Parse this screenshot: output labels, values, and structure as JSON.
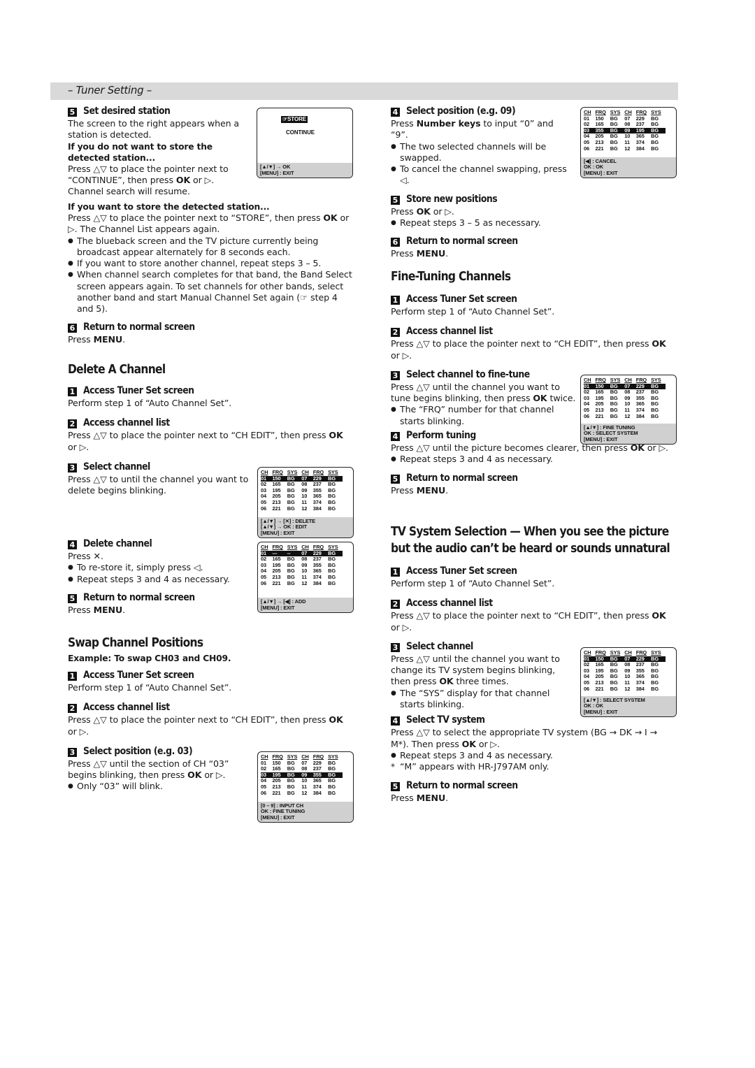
{
  "banner": {
    "title": "– Tuner Setting –"
  },
  "left": {
    "set_desired_station": {
      "num": "5",
      "title": "Set desired station",
      "p1": "The screen to the right appears when a station is detected.",
      "sub1": "If you do not want to store the detected station...",
      "p2a": "Press △▽ to place the pointer next to “CONTINUE”, then press ",
      "p2b": "OK",
      "p2c": " or ▷.",
      "p3": "Channel search will resume.",
      "sub2": "If you want to store the detected station...",
      "p4a": "Press △▽ to place the pointer next to “STORE”, then press ",
      "p4b": "OK",
      "p4c": " or ▷. The Channel List appears again.",
      "bullets": [
        "The blueback screen and the TV picture currently being broadcast appear alternately for 8 seconds each.",
        "If you want to store another channel, repeat steps 3 – 5.",
        "When channel search completes for that band, the Band Select screen appears again. To set channels for other bands, select another band and start Manual Channel Set again (☞ step 4 and 5)."
      ],
      "screen": {
        "store": "☞STORE",
        "continue": "CONTINUE",
        "foot1": "[▲/▼] → OK",
        "foot2": "[MENU] : EXIT"
      }
    },
    "return6": {
      "num": "6",
      "title": "Return to normal screen",
      "text_a": "Press ",
      "text_b": "MENU",
      "text_c": "."
    },
    "delete": {
      "heading": "Delete A Channel",
      "steps": [
        {
          "num": "1",
          "title": "Access Tuner Set screen",
          "text": "Perform step 1 of “Auto Channel Set”."
        },
        {
          "num": "2",
          "title": "Access channel list",
          "text_a": "Press △▽ to place the pointer next to “CH EDIT”, then press ",
          "text_b": "OK",
          "text_c": " or ▷."
        },
        {
          "num": "3",
          "title": "Select channel",
          "text": "Press △▽ to until the channel you want to delete begins blinking."
        },
        {
          "num": "4",
          "title": "Delete channel",
          "text": "Press ✕.",
          "bullets": [
            "To re-store it, simply press ◁.",
            "Repeat steps 3 and 4 as necessary."
          ]
        },
        {
          "num": "5",
          "title": "Return to normal screen",
          "text_a": "Press ",
          "text_b": "MENU",
          "text_c": "."
        }
      ],
      "screen1": {
        "foot": [
          "[▲/▼] → [✕] : DELETE",
          "[▲/▼] → OK : EDIT",
          "[MENU] : EXIT"
        ]
      },
      "screen2": {
        "foot": [
          "[▲/▼] → [◀] : ADD",
          "[MENU] : EXIT"
        ]
      }
    },
    "swap": {
      "heading": "Swap Channel Positions",
      "example": "Example: To swap CH03 and CH09.",
      "steps": [
        {
          "num": "1",
          "title": "Access Tuner Set screen",
          "text": "Perform step 1 of “Auto Channel Set”."
        },
        {
          "num": "2",
          "title": "Access channel list",
          "text_a": "Press △▽ to place the pointer next to “CH EDIT”, then press ",
          "text_b": "OK",
          "text_c": " or ▷."
        },
        {
          "num": "3",
          "title": "Select position (e.g. 03)",
          "text_a": "Press △▽ until the section of CH “03” begins blinking, then press ",
          "text_b": "OK",
          "text_c": " or ▷.",
          "bullets": [
            "Only “03” will blink."
          ]
        }
      ],
      "screen": {
        "foot": [
          "[0 – 9] : INPUT CH",
          "OK : FINE TUNING",
          "[MENU] : EXIT"
        ]
      }
    }
  },
  "right": {
    "swap_cont": {
      "steps": [
        {
          "num": "4",
          "title": "Select position (e.g. 09)",
          "text_a": "Press ",
          "text_b": "Number keys",
          "text_c": " to input “0” and “9”.",
          "bullets": [
            "The two selected channels will be swapped.",
            "To cancel the channel swapping, press ◁."
          ]
        },
        {
          "num": "5",
          "title": "Store new positions",
          "text_a": "Press ",
          "text_b": "OK",
          "text_c": " or ▷.",
          "bullets": [
            "Repeat steps 3 – 5 as necessary."
          ]
        },
        {
          "num": "6",
          "title": "Return to normal screen",
          "text_a": "Press ",
          "text_b": "MENU",
          "text_c": "."
        }
      ],
      "screen": {
        "foot": [
          "[◀] : CANCEL",
          "OK : OK",
          "[MENU] : EXIT"
        ]
      }
    },
    "fine": {
      "heading": "Fine-Tuning Channels",
      "steps": [
        {
          "num": "1",
          "title": "Access Tuner Set screen",
          "text": "Perform step 1 of “Auto Channel Set”."
        },
        {
          "num": "2",
          "title": "Access channel list",
          "text_a": "Press △▽ to place the pointer next to “CH EDIT”, then press ",
          "text_b": "OK",
          "text_c": " or ▷."
        },
        {
          "num": "3",
          "title": "Select channel to fine-tune",
          "text_a": "Press △▽ until the channel you want to tune begins blinking, then press ",
          "text_b": "OK",
          "text_c": " twice.",
          "bullets": [
            "The “FRQ” number for that channel starts blinking."
          ]
        },
        {
          "num": "4",
          "title": "Perform tuning",
          "text_a": "Press △▽ until the picture becomes clearer, then press ",
          "text_b": "OK",
          "text_c": " or ▷.",
          "bullets": [
            "Repeat steps 3 and 4 as necessary."
          ]
        },
        {
          "num": "5",
          "title": "Return to normal screen",
          "text_a": "Press ",
          "text_b": "MENU",
          "text_c": "."
        }
      ],
      "screen": {
        "foot": [
          "[▲/▼] : FINE TUNING",
          "OK : SELECT SYSTEM",
          "[MENU] : EXIT"
        ]
      }
    },
    "tvsys": {
      "heading1": "TV System Selection — When you see the picture",
      "heading2": "but the audio can’t be heard or sounds unnatural",
      "steps": [
        {
          "num": "1",
          "title": "Access Tuner Set screen",
          "text": "Perform step 1 of “Auto Channel Set”."
        },
        {
          "num": "2",
          "title": "Access channel list",
          "text_a": "Press △▽ to place the pointer next to “CH EDIT”, then press ",
          "text_b": "OK",
          "text_c": " or ▷."
        },
        {
          "num": "3",
          "title": "Select channel",
          "text_a": "Press △▽ until the channel you want to change its TV system begins blinking, then press ",
          "text_b": "OK",
          "text_c": " three times.",
          "bullets": [
            "The “SYS” display for that channel starts blinking."
          ]
        },
        {
          "num": "4",
          "title": "Select TV system",
          "text_a": "Press △▽ to select the appropriate TV system (BG → DK → I → M*). Then press ",
          "text_b": "OK",
          "text_c": " or ▷.",
          "bullets": [
            "Repeat steps 3 and 4 as necessary."
          ],
          "note": "“M” appears with HR-J797AM only."
        },
        {
          "num": "5",
          "title": "Return to normal screen",
          "text_a": "Press ",
          "text_b": "MENU",
          "text_c": "."
        }
      ],
      "screen": {
        "foot": [
          "[▲/▼] : SELECT SYSTEM",
          "OK : OK",
          "[MENU] : EXIT"
        ]
      }
    }
  },
  "channel_table": {
    "headers": [
      "CH",
      "FRQ",
      "SYS",
      "CH",
      "FRQ",
      "SYS"
    ],
    "rows": [
      [
        "01",
        "150",
        "BG",
        "07",
        "229",
        "BG"
      ],
      [
        "02",
        "165",
        "BG",
        "08",
        "237",
        "BG"
      ],
      [
        "03",
        "195",
        "BG",
        "09",
        "355",
        "BG"
      ],
      [
        "04",
        "205",
        "BG",
        "10",
        "365",
        "BG"
      ],
      [
        "05",
        "213",
        "BG",
        "11",
        "374",
        "BG"
      ],
      [
        "06",
        "221",
        "BG",
        "12",
        "384",
        "BG"
      ]
    ],
    "deleted_row": [
      "01",
      "---",
      "--",
      "07",
      "229",
      "BG"
    ],
    "swapped_rows": [
      [
        "03",
        "355",
        "BG",
        "09",
        "195",
        "BG"
      ]
    ]
  }
}
